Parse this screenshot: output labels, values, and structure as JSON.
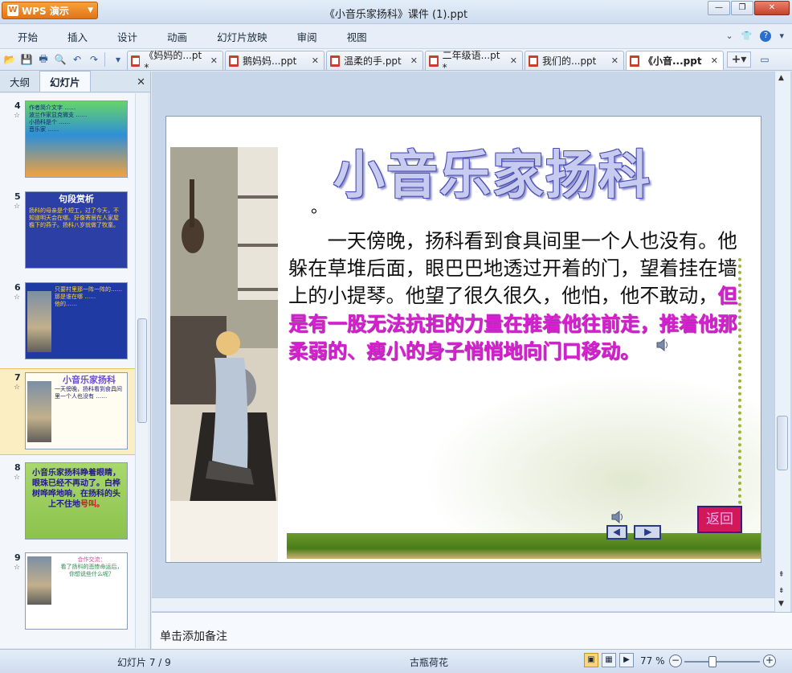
{
  "app": {
    "name": "WPS 演示",
    "logo_glyph": "W"
  },
  "window": {
    "title": "《小音乐家扬科》课件 (1).ppt"
  },
  "menu": [
    "开始",
    "插入",
    "设计",
    "动画",
    "幻灯片放映",
    "审阅",
    "视图"
  ],
  "doc_tabs": [
    {
      "label": "《妈妈的...pt *",
      "active": false
    },
    {
      "label": "鹅妈妈...ppt",
      "active": false
    },
    {
      "label": "温柔的手.ppt",
      "active": false
    },
    {
      "label": "二年级语...pt *",
      "active": false
    },
    {
      "label": "我们的...ppt",
      "active": false
    },
    {
      "label": "《小音...ppt",
      "active": true
    }
  ],
  "left_pane": {
    "tabs": [
      "大纲",
      "幻灯片"
    ],
    "active_tab": "幻灯片",
    "thumbnails": [
      {
        "number": "4",
        "title": "",
        "lines": [
          "作者简介文字 ……",
          "波兰作家显克微支 ……",
          "小扬科是个 ……",
          "音乐家 ……"
        ]
      },
      {
        "number": "5",
        "title": "句段赏析",
        "lines": [
          "扬科的母亲是个短工，过了今天，不知道明天会在哪。好像寄居在人家屋檐下的燕子。扬科八岁就做了牧童。"
        ]
      },
      {
        "number": "6",
        "title": "",
        "lines": [
          "只要村里那一阵一阵的……",
          "那是谁在哪 ……",
          "他的……"
        ]
      },
      {
        "number": "7",
        "title": "小音乐家扬科",
        "lines": [
          "一天傍晚，扬科看到食具间里一个人也没有 ……"
        ]
      },
      {
        "number": "8",
        "title": "",
        "lines": [
          "小音乐家扬科睁着眼睛，眼珠已经不再动了。白桦树哗哗地响，在扬科的头上不住地",
          "号叫。"
        ]
      },
      {
        "number": "9",
        "title": "",
        "lines": [
          "合作交流：",
          "看了扬科的悲惨命运后，你想说些什么呢？"
        ]
      }
    ]
  },
  "slide": {
    "title": "小音乐家扬科",
    "bullet": "。",
    "body_normal": "　　一天傍晚，扬科看到食具间里一个人也没有。他躲在草堆后面，眼巴巴地透过开着的门，望着挂在墙上的小提琴。他望了很久很久，他怕，他不敢动，",
    "body_highlight": "但是有一股无法抗拒的力量在推着他往前走，推着他那柔弱的、瘦小的身子悄悄地向门口移动。",
    "back_button": "返回"
  },
  "notes_placeholder": "单击添加备注",
  "status": {
    "slide_info": "幻灯片 7 / 9",
    "theme": "古瓶荷花",
    "zoom": "77 %"
  },
  "colors": {
    "accent_orange": "#e0741a",
    "highlight_text": "#d91ed3",
    "title_outline": "#4b4fb1",
    "selected_thumb": "#fbeec2"
  }
}
